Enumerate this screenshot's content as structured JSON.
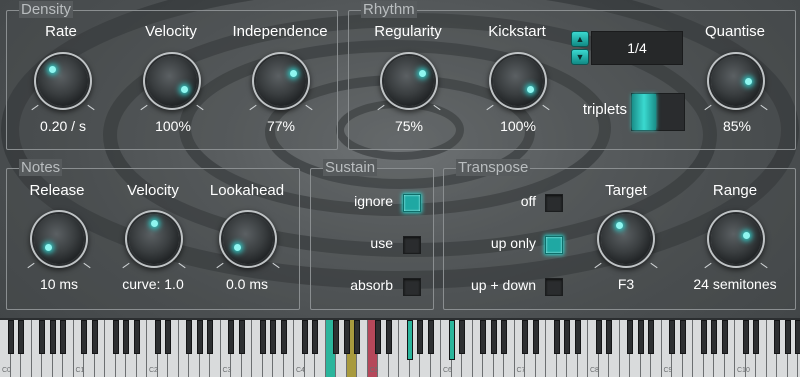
{
  "colors": {
    "accent": "#31d3cf",
    "panel_border": "#8a8e90",
    "highlight_teal": "#2bb59c",
    "highlight_olive": "#a89a3e",
    "highlight_red": "#b5485a"
  },
  "density": {
    "title": "Density",
    "knobs": [
      {
        "label": "Rate",
        "value": "0.20 / s",
        "level": 0.25
      },
      {
        "label": "Velocity",
        "value": "100%",
        "level": 1.0
      },
      {
        "label": "Independence",
        "value": "77%",
        "level": 0.77
      }
    ]
  },
  "rhythm": {
    "title": "Rhythm",
    "knobs": [
      {
        "label": "Regularity",
        "value": "75%",
        "level": 0.75
      },
      {
        "label": "Kickstart",
        "value": "100%",
        "level": 1.0
      },
      {
        "label": "Quantise",
        "value": "85%",
        "level": 0.85
      }
    ],
    "division": "1/4",
    "stepper_up": "▲",
    "stepper_down": "▼",
    "triplets_label": "triplets",
    "triplets_on": true
  },
  "notes": {
    "title": "Notes",
    "knobs": [
      {
        "label": "Release",
        "value": "10 ms",
        "level": 0.1
      },
      {
        "label": "Velocity",
        "value": "curve: 1.0",
        "level": 0.5
      },
      {
        "label": "Lookahead",
        "value": "0.0 ms",
        "level": 0.0
      }
    ]
  },
  "sustain": {
    "title": "Sustain",
    "options": [
      {
        "label": "ignore",
        "checked": true
      },
      {
        "label": "use",
        "checked": false
      },
      {
        "label": "absorb",
        "checked": false
      }
    ]
  },
  "transpose": {
    "title": "Transpose",
    "options": [
      {
        "label": "off",
        "checked": false
      },
      {
        "label": "up only",
        "checked": true
      },
      {
        "label": "up + down",
        "checked": false
      }
    ],
    "knobs": [
      {
        "label": "Target",
        "value": "F3",
        "level": 0.45
      },
      {
        "label": "Range",
        "value": "24 semitones",
        "level": 0.8
      }
    ]
  },
  "keyboard": {
    "octave_labels": [
      "C0",
      "C1",
      "C2",
      "C3",
      "C4",
      "C5",
      "C6",
      "C7",
      "C8",
      "C9",
      "C10"
    ]
  }
}
